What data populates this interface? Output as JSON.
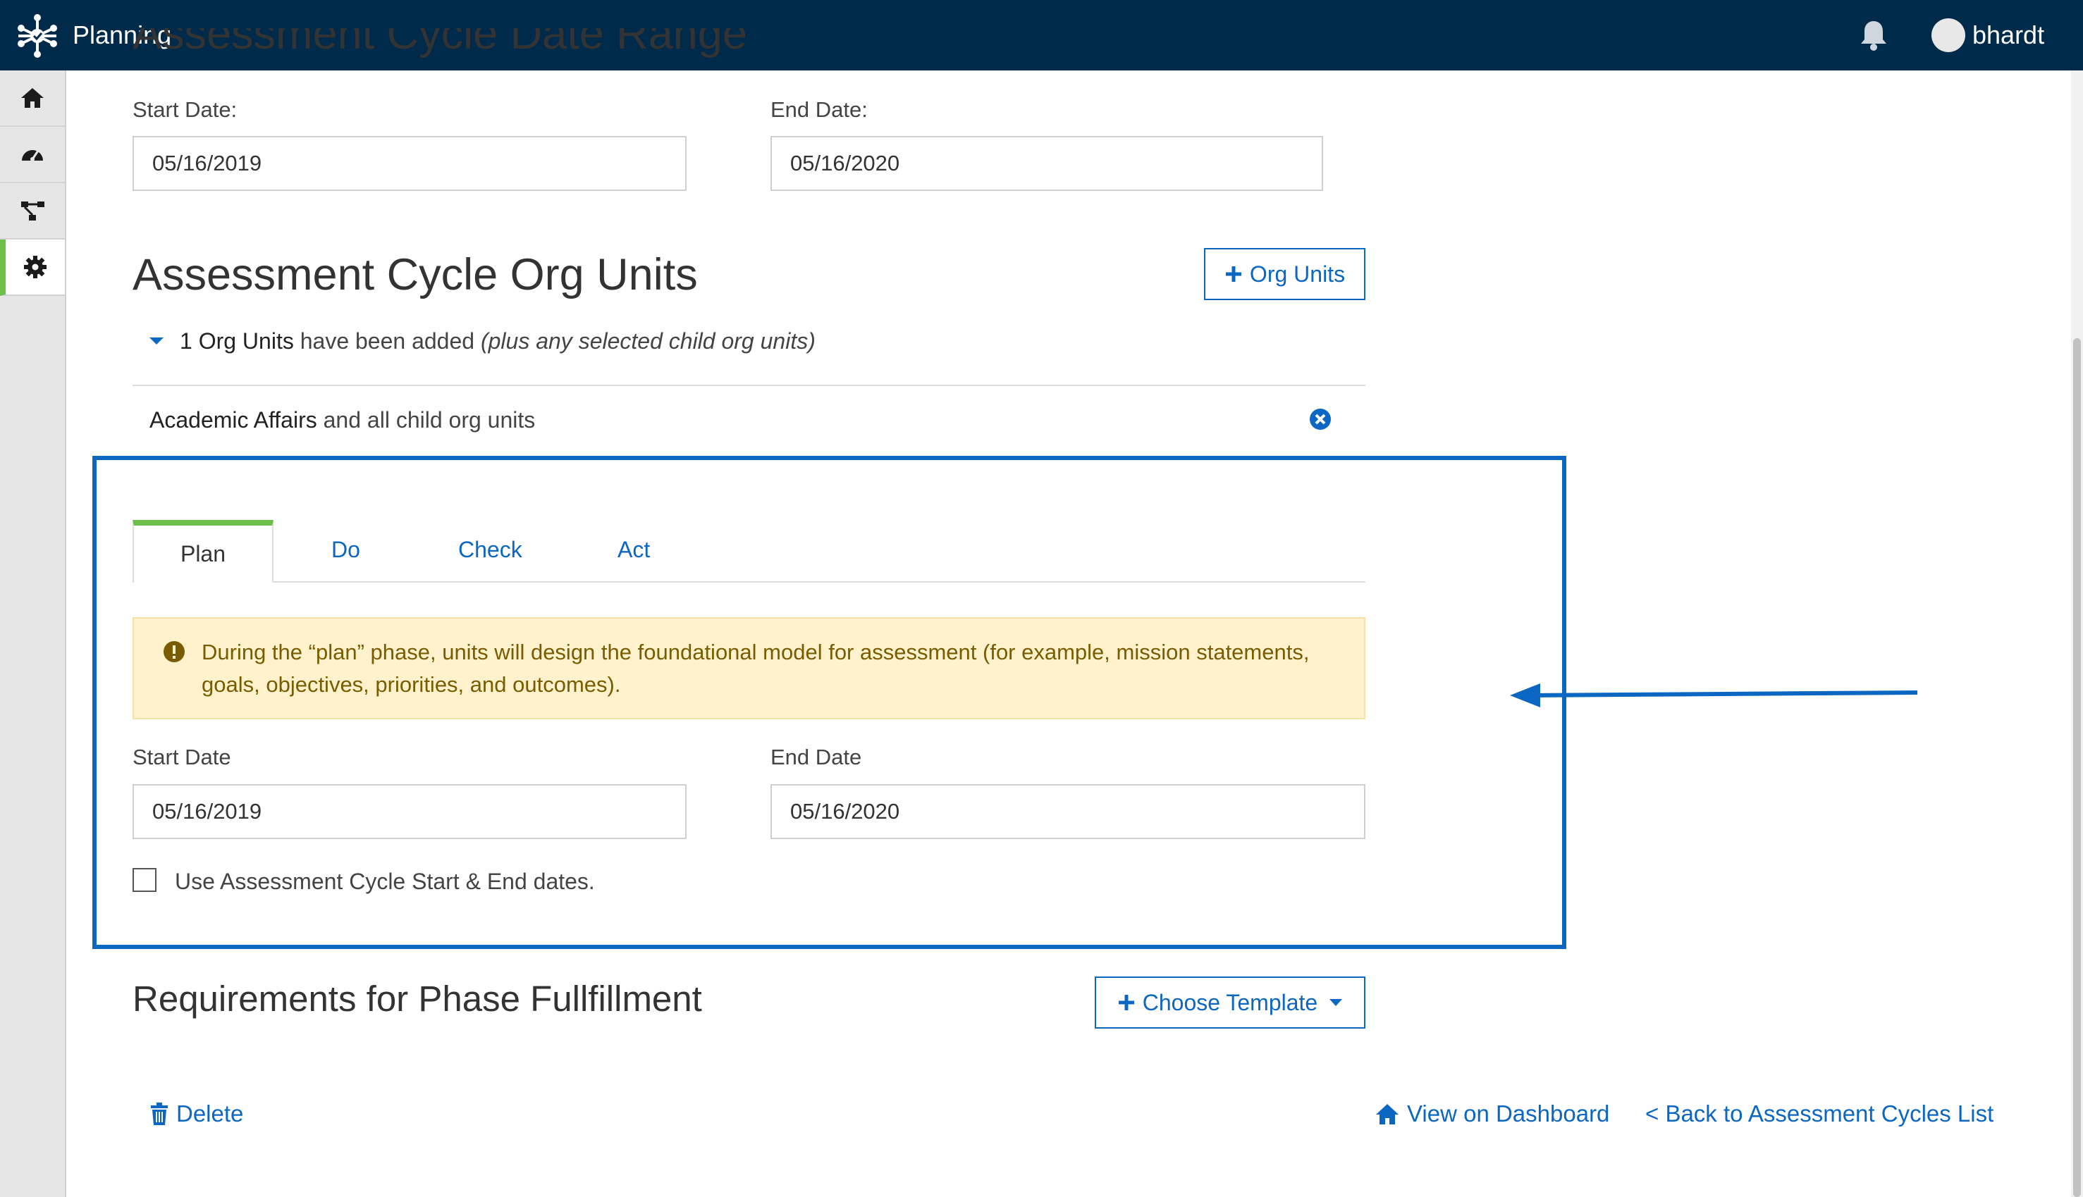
{
  "header": {
    "app_title": "Planning",
    "username": "bhardt",
    "logo_icon": "network-nodes-logo-icon",
    "bell_icon": "bell-icon"
  },
  "sidebar": {
    "items": [
      {
        "name": "home",
        "icon": "home-icon"
      },
      {
        "name": "dashboard",
        "icon": "speedometer-icon"
      },
      {
        "name": "structure",
        "icon": "hierarchy-icon"
      },
      {
        "name": "settings",
        "icon": "gear-icon",
        "active": true
      }
    ]
  },
  "date_range": {
    "heading": "Assessment Cycle Date Range",
    "start_label": "Start Date:",
    "start_value": "05/16/2019",
    "end_label": "End Date:",
    "end_value": "05/16/2020"
  },
  "org_units": {
    "heading": "Assessment Cycle Org Units",
    "add_button": "Org Units",
    "summary_count": "1 Org Units",
    "summary_text": " have been added ",
    "summary_note": "(plus any selected child org units)",
    "item_name": "Academic Affairs",
    "item_suffix": " and all child org units"
  },
  "phases": {
    "tabs": [
      "Plan",
      "Do",
      "Check",
      "Act"
    ],
    "active_tab": "Plan",
    "alert_text": "During the “plan” phase, units will design the foundational model for assessment (for example, mission statements, goals, objectives, priorities, and outcomes).",
    "start_label": "Start Date",
    "start_value": "05/16/2019",
    "end_label": "End Date",
    "end_value": "05/16/2020",
    "checkbox_label": "Use Assessment Cycle Start & End dates.",
    "checkbox_checked": false
  },
  "requirements": {
    "heading": "Requirements for Phase Fullfillment",
    "choose_template": "Choose Template"
  },
  "footer": {
    "delete": "Delete",
    "view_dashboard": "View on Dashboard",
    "back_link": "< Back to Assessment Cycles List"
  },
  "colors": {
    "topbar": "#002a4a",
    "accent": "#0b67c2",
    "active_green": "#6cc04a",
    "alert_bg": "#fff2cc",
    "alert_text": "#7a5c00"
  }
}
